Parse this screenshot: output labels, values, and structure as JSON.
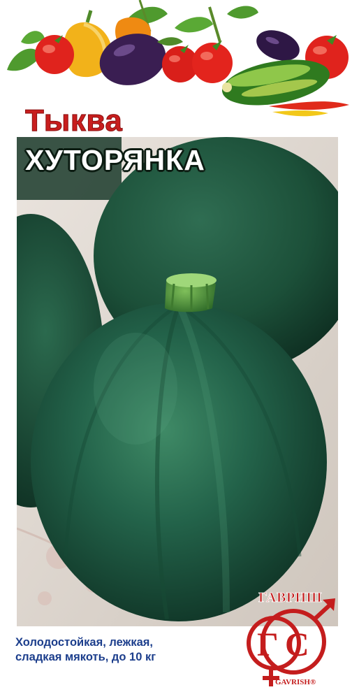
{
  "packet": {
    "crop_label": "Тыква",
    "variety_label": "ХУТОРЯНКА",
    "description_lines": [
      "Холодостойкая, лежкая,",
      "сладкая мякоть, до 10 кг"
    ]
  },
  "brand": {
    "name_ru": "ГАВРИШ",
    "name_lat": "GAVRISH",
    "registered_mark": "®",
    "emblem_letters": [
      "Г",
      "С"
    ]
  },
  "colors": {
    "title_red": "#c81e1e",
    "caption_blue": "#1c3e8c",
    "pumpkin_green": "#1f5a3e",
    "logo_red": "#c41d1d"
  },
  "icons": [
    "tomato-icon",
    "bell-pepper-icon",
    "eggplant-icon",
    "zucchini-icon",
    "chili-pepper-icon",
    "male-symbol-icon",
    "female-symbol-icon"
  ]
}
